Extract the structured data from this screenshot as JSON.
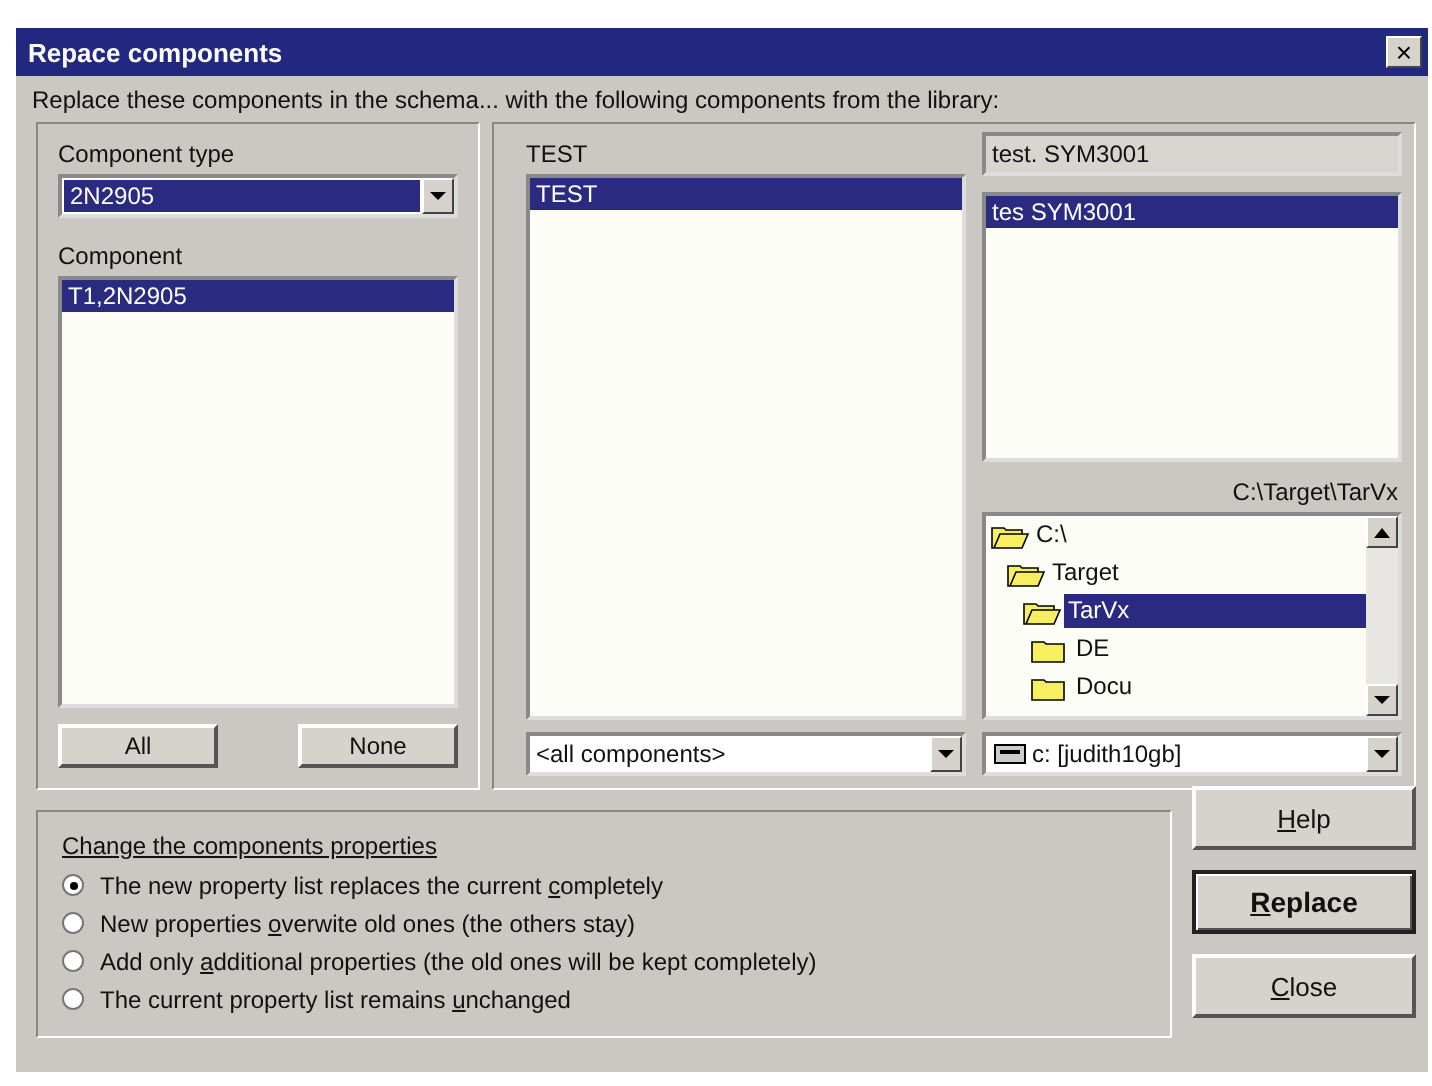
{
  "window": {
    "title": "Repace components",
    "close": "×"
  },
  "instruction": "Replace these components in the schema... with the following components from the library:",
  "left": {
    "type_label": "Component type",
    "type_value": "2N2905",
    "component_label": "Component",
    "components": [
      {
        "label": "T1,2N2905",
        "selected": true
      }
    ],
    "buttons": [
      "All",
      "None"
    ]
  },
  "library": {
    "title": "TEST",
    "items": [
      {
        "label": "TEST",
        "selected": true
      }
    ],
    "filter": "<all components>"
  },
  "symbol": {
    "field": "test. SYM3001",
    "items": [
      {
        "label": "tes SYM3001",
        "selected": true
      }
    ],
    "path": "C:\\Target\\TarVx",
    "folders": [
      {
        "label": "C:\\",
        "open": true,
        "selected": false,
        "children": [
          {
            "label": "Target",
            "open": true,
            "selected": false,
            "children": [
              {
                "label": "TarVx",
                "open": true,
                "selected": true,
                "children": [
                  {
                    "label": "DE",
                    "open": false,
                    "selected": false
                  },
                  {
                    "label": "Docu",
                    "open": false,
                    "selected": false
                  }
                ]
              }
            ]
          }
        ]
      }
    ],
    "drive": "c: [judith10gb]"
  },
  "properties": {
    "title": "Change the components properties",
    "options": [
      {
        "label": [
          "The new property list replaces the current ",
          "c",
          "ompletely"
        ],
        "selected": true
      },
      {
        "label": [
          "New properties ",
          "o",
          "verwite old ones (the others stay)"
        ],
        "selected": false
      },
      {
        "label": [
          "Add only ",
          "a",
          "dditional properties (the old ones will be kept completely)"
        ],
        "selected": false
      },
      {
        "label": [
          "The current property list remains ",
          "u",
          "nchanged"
        ],
        "selected": false
      }
    ]
  },
  "actions": [
    {
      "key": "H",
      "rest": "elp",
      "default": false
    },
    {
      "key": "R",
      "rest": "eplace",
      "default": true
    },
    {
      "key": "C",
      "rest": "lose",
      "default": false
    }
  ]
}
